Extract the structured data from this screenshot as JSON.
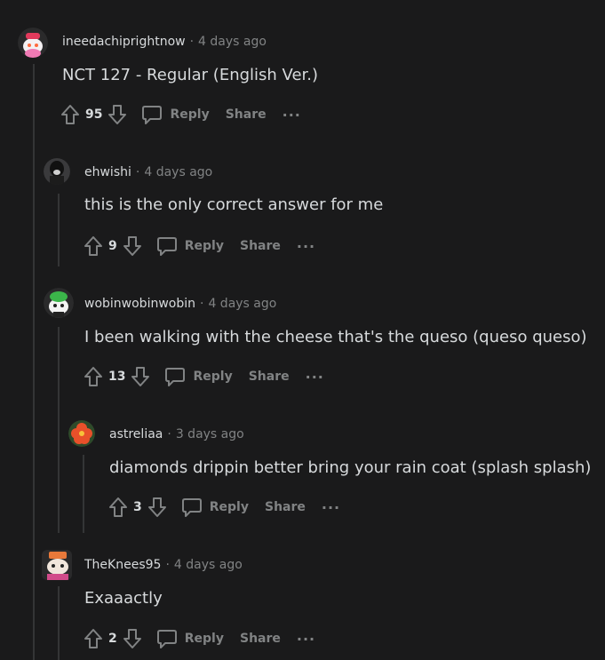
{
  "comments": [
    {
      "username": "ineedachiprightnow",
      "separator": "·",
      "time": "4 days ago",
      "body": "NCT 127 - Regular (English Ver.)",
      "score": "95",
      "reply_label": "Reply",
      "share_label": "Share",
      "more_label": "···"
    },
    {
      "username": "ehwishi",
      "separator": "·",
      "time": "4 days ago",
      "body": "this is the only correct answer for me",
      "score": "9",
      "reply_label": "Reply",
      "share_label": "Share",
      "more_label": "···"
    },
    {
      "username": "wobinwobinwobin",
      "separator": "·",
      "time": "4 days ago",
      "body": "I been walking with the cheese that's the queso (queso queso)",
      "score": "13",
      "reply_label": "Reply",
      "share_label": "Share",
      "more_label": "···"
    },
    {
      "username": "astreliaa",
      "separator": "·",
      "time": "3 days ago",
      "body": "diamonds drippin better bring your rain coat (splash splash)",
      "score": "3",
      "reply_label": "Reply",
      "share_label": "Share",
      "more_label": "···"
    },
    {
      "username": "TheKnees95",
      "separator": "·",
      "time": "4 days ago",
      "body": "Exaaactly",
      "score": "2",
      "reply_label": "Reply",
      "share_label": "Share",
      "more_label": "···"
    }
  ]
}
